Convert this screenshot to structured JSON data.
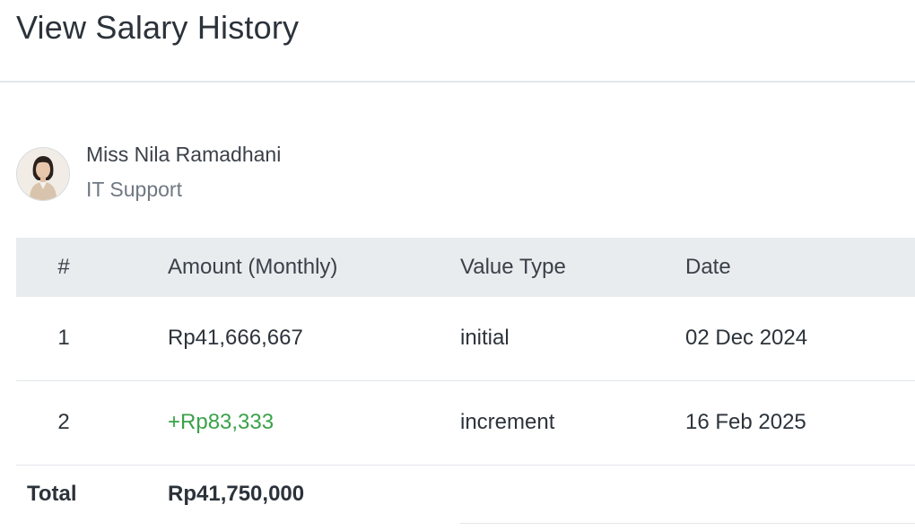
{
  "modal": {
    "title": "View Salary History"
  },
  "employee": {
    "name": "Miss Nila Ramadhani",
    "role": "IT Support"
  },
  "table": {
    "columns": [
      "#",
      "Amount (Monthly)",
      "Value Type",
      "Date"
    ],
    "rows": [
      {
        "num": "1",
        "amount": "Rp41,666,667",
        "type": "initial",
        "date": "02 Dec 2024"
      },
      {
        "num": "2",
        "amount": "+Rp83,333",
        "type": "increment",
        "date": "16 Feb 2025"
      }
    ],
    "total_label": "Total",
    "total_amount": "Rp41,750,000"
  },
  "colors": {
    "increment_text": "#3aa24a",
    "header_bg": "#e9ecef"
  }
}
